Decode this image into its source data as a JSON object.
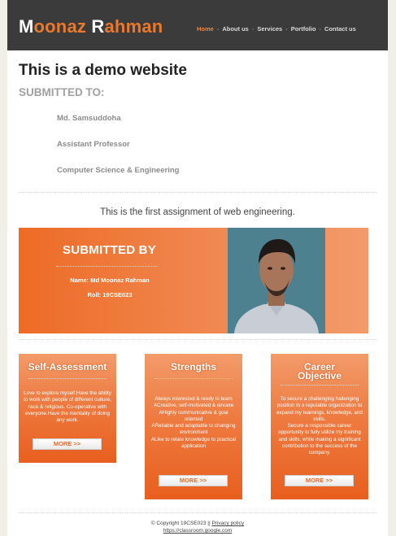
{
  "header": {
    "logo_first_cap": "M",
    "logo_first_rest": "oonaz ",
    "logo_last_cap": "R",
    "logo_last_rest": "ahman",
    "nav": [
      "Home",
      "About us",
      "Services",
      "Portfolio",
      "Contact us"
    ],
    "nav_separator": "-",
    "active_nav": "Home"
  },
  "intro": {
    "title": "This is a demo website",
    "submitted_to_heading": "SUBMITTED TO:",
    "name": "Md. Samsuddoha",
    "designation": "Assistant Professor",
    "department": "Computer Science & Engineering",
    "assignment_note": "This is the first assignment of web engineering."
  },
  "submitted_by": {
    "heading": "SUBMITTED BY",
    "name_line": "Name: Md Moonaz Rahman",
    "roll_line": "Roll: 19CSE023",
    "photo": "person-portrait"
  },
  "cards": [
    {
      "title": "Self-Assessment",
      "text": "Love to explore myself.Have the ability to work with people of different culture, race & religious. Co-operative with everyone.Have the mentality of doing any work.",
      "button": "MORE >>"
    },
    {
      "title": "Strengths",
      "text": "Always interested & ready to learn\nACreative, self-motivated & sincere\nAHighly communicative & goal oriented\nAReliable and adaptable to changing environment\nALike to relate knowledge to practical application",
      "button": "MORE >>"
    },
    {
      "title": "Career Objective",
      "text": "To secure a challenging hallenging position in a reputable organization to expand my learnings, knowledge, and skills.\nSecure a responsible career opportunity to fully utilize my training and skills, while making a significant contribution to the success of the company.",
      "button": "MORE >>"
    }
  ],
  "footer": {
    "copyright": "© Copyright 19CSE023 || ",
    "privacy_link": "Privacy policy",
    "url_link": "https://classroom.google.com"
  },
  "colors": {
    "header_bg": "#3b3b3b",
    "accent": "#ee6b25",
    "logo": "#e87a2e"
  }
}
